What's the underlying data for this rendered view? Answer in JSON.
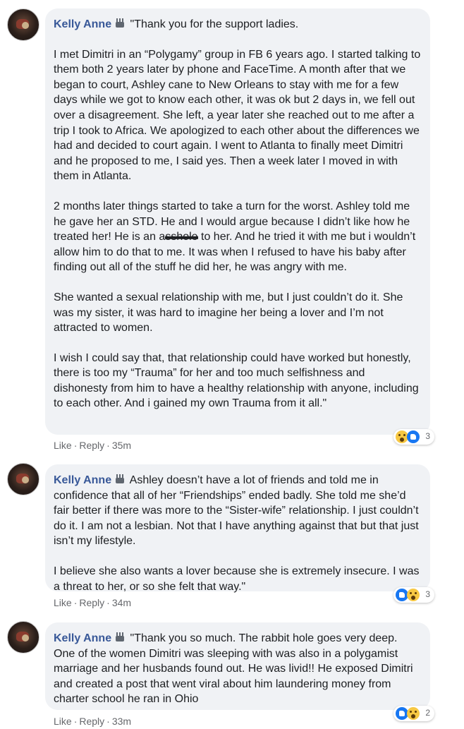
{
  "comments": [
    {
      "author": "Kelly Anne",
      "paragraphs": [
        "\"Thank you for the support ladies.",
        "I met Dimitri in an “Polygamy” group in FB 6 years ago. I started talking to them both 2 years later by phone and FaceTime. A month after that we began to court, Ashley cane to New Orleans to stay with me for a few days while we got to know each other, it was ok but 2 days in, we fell out over a disagreement. She left, a year later she reached out to me after a trip I took to Africa. We apologized to each other about the differences we had and decided to court again. I went to Atlanta to finally meet Dimitri and he proposed to me, I said yes. Then a week later I moved in with them in Atlanta.",
        "2 months later things started to take a turn for the worst. Ashley told me he gave her an STD. He and I would argue because I didn’t like how he treated her! He is an",
        "She wanted a sexual relationship with me, but I just couldn’t do it. She was my sister, it was hard to imagine her being a lover and I’m not attracted to women.",
        "I wish I could say that, that relationship could have worked but honestly, there is too my “Trauma” for her and too much selfishness and dishonesty from him to have a healthy relationship with anyone, including to each other. And i gained my own Trauma from it all.\""
      ],
      "p3_part1": "2 months later things started to take a turn for the worst. Ashley told me he gave her an STD. He and I would argue because I didn’t like how he treated her! He is an a",
      "p3_redacted": "sshole",
      "p3_part2": " to her. And he tried it with me but i wouldn’t allow him to do that to me. It was when I refused to have his baby after finding out all of the stuff he did her, he was angry with me.",
      "reaction_count": "3",
      "like_label": "Like",
      "reply_label": "Reply",
      "time": "35m"
    },
    {
      "author": "Kelly Anne",
      "paragraphs": [
        "Ashley doesn’t have a lot of friends and told me in confidence that all of her “Friendships” ended badly. She told me she’d fair better if there was more to the “Sister-wife” relationship. I just couldn’t do it. I am not a lesbian. Not that I have anything against that but that just isn’t my lifestyle.",
        "I believe she also wants a lover because she is extremely insecure. I was a threat to her, or so she felt that way.\""
      ],
      "reaction_count": "3",
      "like_label": "Like",
      "reply_label": "Reply",
      "time": "34m"
    },
    {
      "author": "Kelly Anne",
      "paragraphs": [
        "\"Thank you so much. The rabbit hole goes very deep. One of the women Dimitri was sleeping with was also in a polygamist marriage and her husbands found out. He was livid!! He exposed Dimitri and created a post that went viral about him laundering money from charter school he ran in Ohio"
      ],
      "reaction_count": "2",
      "like_label": "Like",
      "reply_label": "Reply",
      "time": "33m"
    }
  ],
  "colors": {
    "author": "#385898",
    "bubble": "#f0f2f5",
    "meta": "#65676b"
  },
  "icons": [
    "avatar",
    "crown-icon",
    "wow-reaction-icon",
    "like-reaction-icon"
  ]
}
